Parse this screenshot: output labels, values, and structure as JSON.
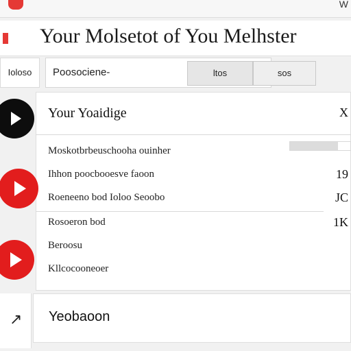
{
  "header": {
    "title": "Your Molsetot of You Melhster",
    "corner_text": "W"
  },
  "toolbar": {
    "left_button_label": "Ioloso",
    "search_value": "Poosociene-",
    "tabs": [
      {
        "label": "ltos"
      },
      {
        "label": "sos"
      }
    ]
  },
  "list": {
    "section_title": "Your Yoaidige",
    "section_value": "X",
    "progress": 0.8,
    "items": [
      {
        "text": "Moskotbrbeuschooha ouinher",
        "value": ""
      },
      {
        "text": "Ihhon poocbooesve faoon",
        "value": "19"
      },
      {
        "text": "Roeneeno bod Ioloo Seoobo",
        "value": "JC"
      },
      {
        "text": "Rosoeron bod",
        "value": "1K"
      },
      {
        "text": "Beroosu",
        "value": ""
      },
      {
        "text": "Kllcocooneoer",
        "value": ""
      }
    ]
  },
  "footer": {
    "text": "Yeobaoon",
    "nav_glyph": "↗"
  },
  "colors": {
    "accent_red": "#e21d1d",
    "dark_play": "#0d0d0d",
    "panel_bg": "#ffffff",
    "page_bg": "#f1f1f1"
  },
  "icons": {
    "play_icons": [
      "play-icon",
      "play-icon",
      "play-icon"
    ],
    "nav_icon": "arrow-nav-icon"
  }
}
